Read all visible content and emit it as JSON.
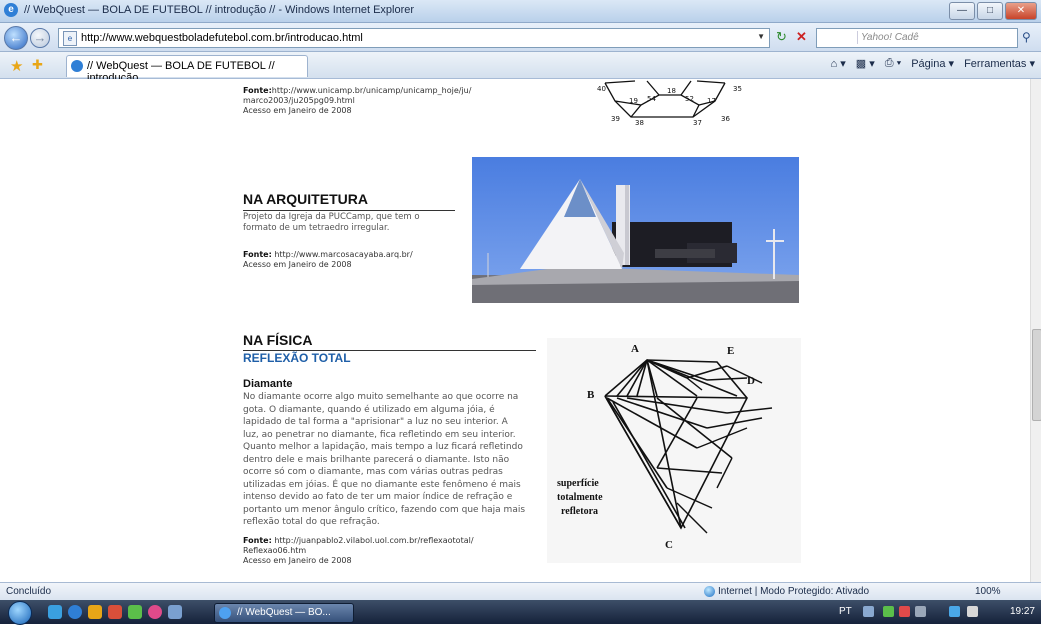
{
  "window": {
    "title": "// WebQuest — BOLA DE FUTEBOL // introdução // - Windows Internet Explorer",
    "minimize": "—",
    "maximize": "□",
    "close": "✕"
  },
  "address_bar": {
    "url": "http://www.webquestboladefutebol.com.br/introducao.html",
    "search_placeholder": "Yahoo! Cadê"
  },
  "tabs": {
    "active_tab": "// WebQuest — BOLA DE FUTEBOL // introdução..."
  },
  "command_bar": {
    "page_label": "Página",
    "tools_label": "Ferramentas"
  },
  "page": {
    "top_source": {
      "fonte_label": "Fonte:",
      "fonte_text": "http://www.unicamp.br/unicamp/unicamp_hoje/ju/",
      "fonte_line2": "marco2003/ju205pg09.html",
      "accessed": "Acesso em Janeiro de 2008"
    },
    "polyhedron_numbers": [
      "40",
      "19",
      "54",
      "18",
      "52",
      "17",
      "35",
      "39",
      "38",
      "37",
      "36"
    ],
    "arquitetura": {
      "heading": "NA ARQUITETURA",
      "text_line1": "Projeto da Igreja da PUCCamp, que tem o",
      "text_line2": "formato de um tetraedro irregular.",
      "fonte_label": "Fonte:",
      "fonte_text": "http://www.marcosacayaba.arq.br/",
      "accessed": "Acesso em Janeiro de 2008"
    },
    "fisica": {
      "heading": "NA FÍSICA",
      "subheading": "REFLEXÃO TOTAL",
      "diamante_title": "Diamante",
      "diamante_lines": [
        "No diamante ocorre algo muito semelhante ao que ocorre na",
        "gota. O diamante, quando é utilizado em alguma jóia, é",
        "lapidado de tal forma a \"aprisionar\" a luz no seu interior. A",
        "luz, ao penetrar no diamante, fica refletindo em seu interior.",
        "Quanto melhor a lapidação, mais tempo a luz ficará refletindo",
        "dentro dele e mais brilhante parecerá o diamante. Isto não",
        "ocorre só com o diamante, mas com várias outras pedras",
        "utilizadas em jóias. É que no diamante este fenômeno é mais",
        "intenso devido ao fato de ter um maior índice de refração e",
        "portanto um menor ângulo crítico, fazendo com que haja mais",
        "reflexão total do que refração."
      ],
      "fonte_label": "Fonte:",
      "fonte_text": "http://juanpablo2.vilabol.uol.com.br/reflexaototal/",
      "fonte_line2": "Reflexao06.htm",
      "accessed": "Acesso em Janeiro de 2008",
      "diagram_labels": {
        "a": "A",
        "b": "B",
        "c": "C",
        "d": "D",
        "e": "E",
        "caption_line1": "superfície",
        "caption_line2": "totalmente",
        "caption_line3": "refletora"
      }
    }
  },
  "status_bar": {
    "status": "Concluído",
    "zone": "Internet | Modo Protegido: Ativado",
    "zoom": "100%"
  },
  "taskbar": {
    "window_button": "// WebQuest — BO...",
    "lang": "PT",
    "time": "19:27"
  }
}
